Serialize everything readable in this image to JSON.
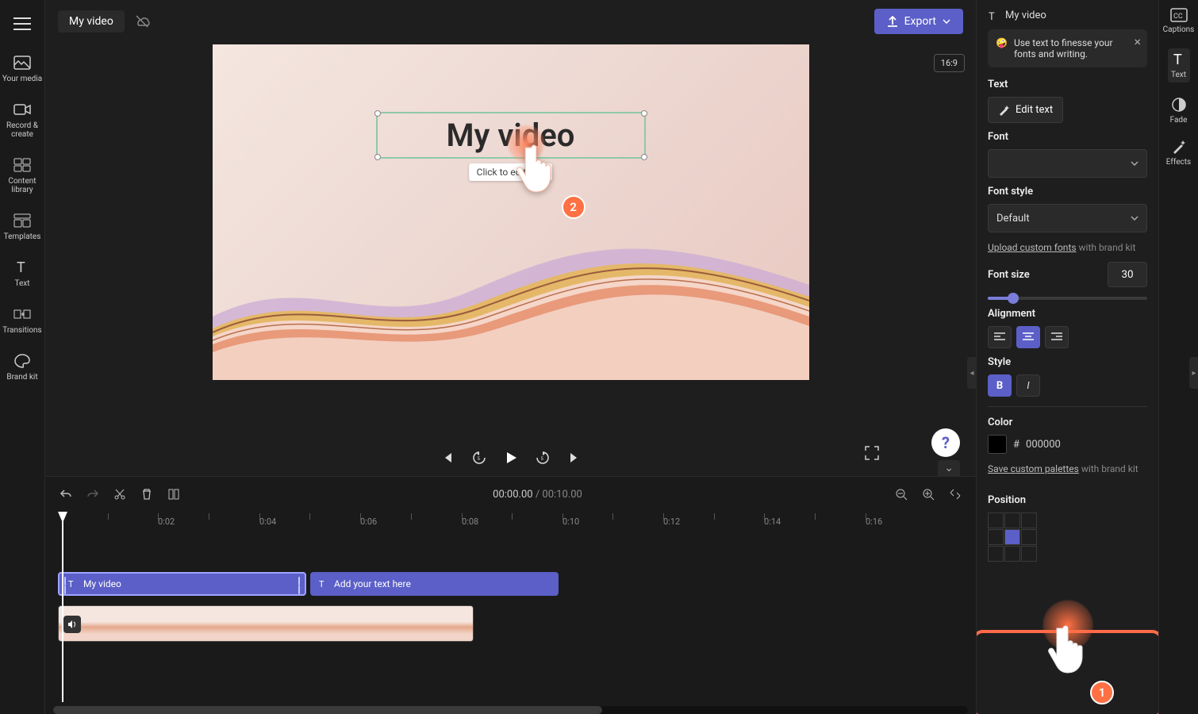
{
  "header": {
    "project_title": "My video",
    "export_label": "Export"
  },
  "left_rail": {
    "your_media": "Your media",
    "record_create": "Record & create",
    "content_library": "Content library",
    "templates": "Templates",
    "text": "Text",
    "transitions": "Transitions",
    "brand_kit": "Brand kit"
  },
  "preview": {
    "aspect": "16:9",
    "overlay_title": "My video",
    "edit_hint": "Click to edit text",
    "marker2_number": "2"
  },
  "playback": {
    "current": "00:00.00",
    "total": "00:10.00"
  },
  "timeline": {
    "ticks": [
      "0:02",
      "0:04",
      "0:06",
      "0:08",
      "0:10",
      "0:12",
      "0:14",
      "0:16"
    ],
    "clip1_label": "My video",
    "clip2_label": "Add your text here"
  },
  "right_panel": {
    "header_title": "My video",
    "tip_text": "Use text to finesse your fonts and writing.",
    "text_label": "Text",
    "edit_text_btn": "Edit text",
    "font_label": "Font",
    "font_value": "",
    "font_style_label": "Font style",
    "font_style_value": "Default",
    "upload_fonts_link": "Upload custom fonts",
    "upload_fonts_suffix": " with brand kit",
    "font_size_label": "Font size",
    "font_size_value": "30",
    "alignment_label": "Alignment",
    "style_label": "Style",
    "bold_label": "B",
    "italic_label": "I",
    "color_label": "Color",
    "color_hash": "#",
    "color_value": "000000",
    "palettes_link": "Save custom palettes",
    "palettes_suffix": " with brand kit",
    "position_label": "Position",
    "marker1_number": "1"
  },
  "far_rail": {
    "captions": "Captions",
    "text": "Text",
    "fade": "Fade",
    "effects": "Effects"
  },
  "help": {
    "symbol": "?"
  }
}
